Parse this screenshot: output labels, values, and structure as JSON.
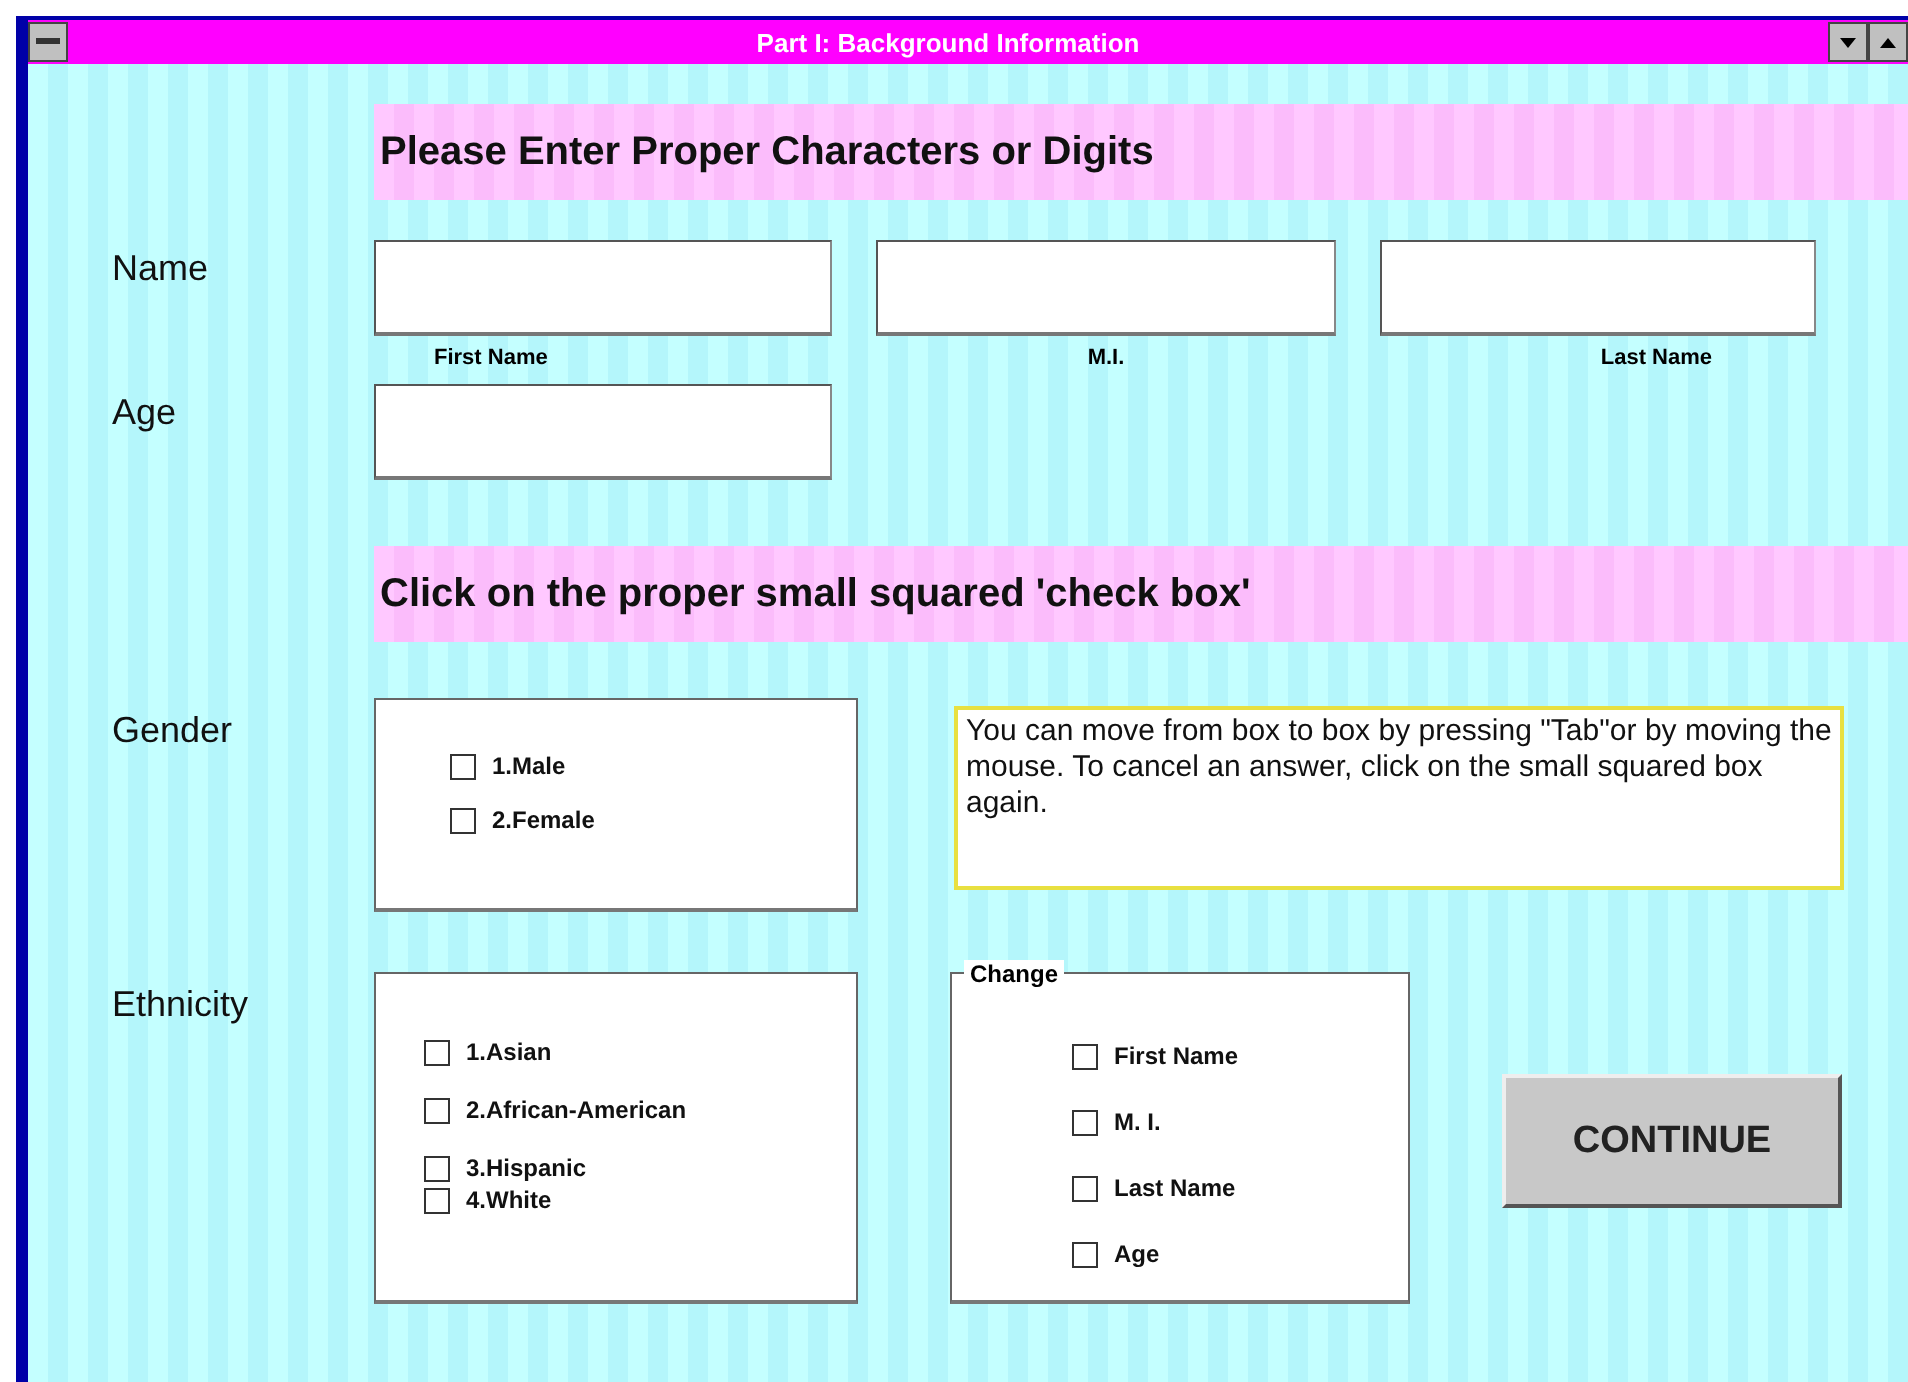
{
  "window": {
    "title": "Part I: Background Information"
  },
  "sections": [
    {
      "heading": "Please Enter Proper Characters or Digits"
    },
    {
      "heading": "Click on the proper small squared 'check box'"
    }
  ],
  "name": {
    "label": "Name",
    "fields": [
      {
        "caption": "First Name"
      },
      {
        "caption": "M.I."
      },
      {
        "caption": "Last Name"
      }
    ]
  },
  "age": {
    "label": "Age"
  },
  "gender": {
    "label": "Gender",
    "options": [
      {
        "label": "1.Male",
        "checked": false
      },
      {
        "label": "2.Female",
        "checked": false
      }
    ]
  },
  "hint": "You can move from box to box by pressing \"Tab\"or by moving the mouse. To cancel an answer, click on the small squared box again.",
  "ethnicity": {
    "label": "Ethnicity",
    "options": [
      {
        "label": "1.Asian",
        "checked": false
      },
      {
        "label": "2.African-American",
        "checked": false
      },
      {
        "label": "3.Hispanic",
        "checked": false
      },
      {
        "label": "4.White",
        "checked": false
      }
    ]
  },
  "change": {
    "title": "Change",
    "options": [
      {
        "label": "First Name",
        "checked": false
      },
      {
        "label": "M. I.",
        "checked": false
      },
      {
        "label": "Last Name",
        "checked": false
      },
      {
        "label": "Age",
        "checked": false
      }
    ]
  },
  "continue_button": "CONTINUE"
}
